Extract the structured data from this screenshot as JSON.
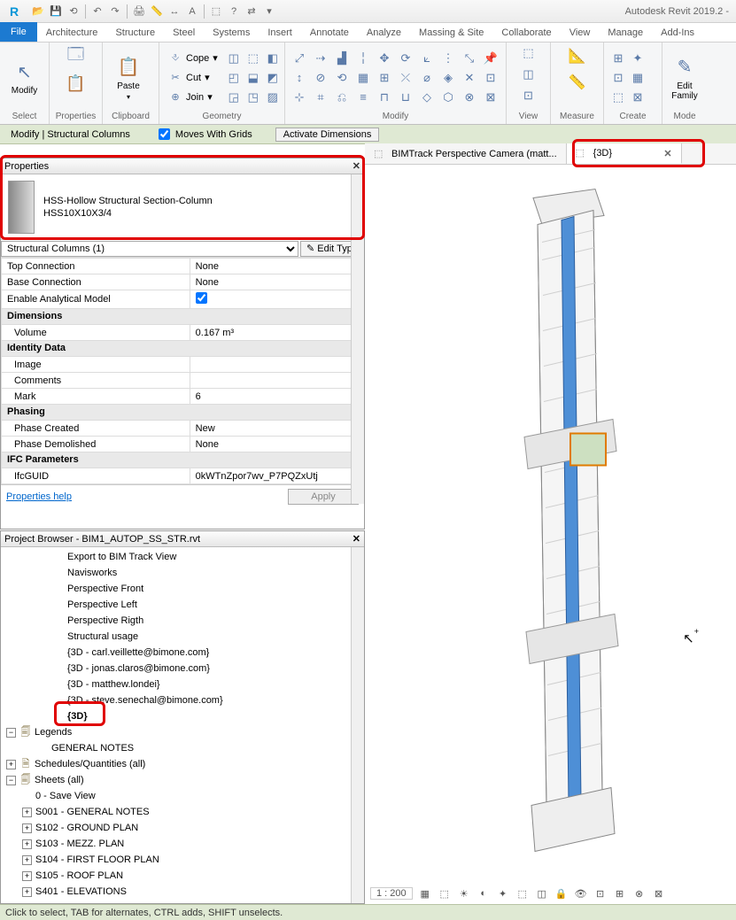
{
  "app": {
    "title": "Autodesk Revit 2019.2 -"
  },
  "qat_icons": [
    "open",
    "save",
    "sync",
    "undo",
    "redo",
    "print",
    "measure",
    "text-a",
    "cube",
    "question",
    "switch",
    "dropdown"
  ],
  "tabs": {
    "file": "File",
    "items": [
      "Architecture",
      "Structure",
      "Steel",
      "Systems",
      "Insert",
      "Annotate",
      "Analyze",
      "Massing & Site",
      "Collaborate",
      "View",
      "Manage",
      "Add-Ins"
    ]
  },
  "ribbon": {
    "select": {
      "modify": "Modify",
      "select": "Select",
      "properties": "Properties",
      "panel": "Properties"
    },
    "clipboard": {
      "paste": "Paste",
      "panel": "Clipboard",
      "cope": "Cope",
      "cut": "Cut",
      "join": "Join"
    },
    "geometry": {
      "panel": "Geometry"
    },
    "modify": {
      "panel": "Modify"
    },
    "view": {
      "panel": "View"
    },
    "measure": {
      "panel": "Measure"
    },
    "create": {
      "panel": "Create"
    },
    "mode": {
      "edit_family": "Edit\nFamily",
      "panel": "Mode"
    }
  },
  "options": {
    "context": "Modify | Structural Columns",
    "moves_with_grids": "Moves With Grids",
    "activate_dims": "Activate Dimensions"
  },
  "doc_tabs": {
    "bim_track": "BIMTrack Perspective Camera (matt...",
    "three_d": "{3D}"
  },
  "properties": {
    "title": "Properties",
    "type_line1": "HSS-Hollow Structural Section-Column",
    "type_line2": "HSS10X10X3/4",
    "category": "Structural Columns (1)",
    "edit_type": "Edit Type",
    "rows": {
      "top_connection": {
        "k": "Top Connection",
        "v": "None"
      },
      "base_connection": {
        "k": "Base Connection",
        "v": "None"
      },
      "enable_analytical": {
        "k": "Enable Analytical Model",
        "v": true
      }
    },
    "dimensions": {
      "label": "Dimensions",
      "volume_k": "Volume",
      "volume_v": "0.167 m³"
    },
    "identity": {
      "label": "Identity Data",
      "image": "Image",
      "comments": "Comments",
      "mark_k": "Mark",
      "mark_v": "6"
    },
    "phasing": {
      "label": "Phasing",
      "created_k": "Phase Created",
      "created_v": "New",
      "demolished_k": "Phase Demolished",
      "demolished_v": "None"
    },
    "ifc": {
      "label": "IFC Parameters",
      "guid_k": "IfcGUID",
      "guid_v": "0kWTnZpor7wv_P7PQZxUtj"
    },
    "help": "Properties help",
    "apply": "Apply"
  },
  "pb": {
    "title": "Project Browser - BIM1_AUTOP_SS_STR.rvt",
    "views": [
      "Export to BIM Track View",
      "Navisworks",
      "Perspective Front",
      "Perspective Left",
      "Perspective Rigth",
      "Structural usage",
      "{3D - carl.veillette@bimone.com}",
      "{3D - jonas.claros@bimone.com}",
      "{3D - matthew.londei}",
      "{3D - steve.senechal@bimone.com}",
      "{3D}"
    ],
    "legends": "Legends",
    "general_notes": "GENERAL NOTES",
    "schedules": "Schedules/Quantities (all)",
    "sheets": "Sheets (all)",
    "sheet_items": [
      "0 - Save View",
      "S001 - GENERAL NOTES",
      "S102 - GROUND PLAN",
      "S103 - MEZZ. PLAN",
      "S104 - FIRST FLOOR PLAN",
      "S105 - ROOF PLAN",
      "S401 - ELEVATIONS"
    ]
  },
  "viewctrl": {
    "scale": "1 : 200"
  },
  "status": "Click to select, TAB for alternates, CTRL adds, SHIFT unselects."
}
